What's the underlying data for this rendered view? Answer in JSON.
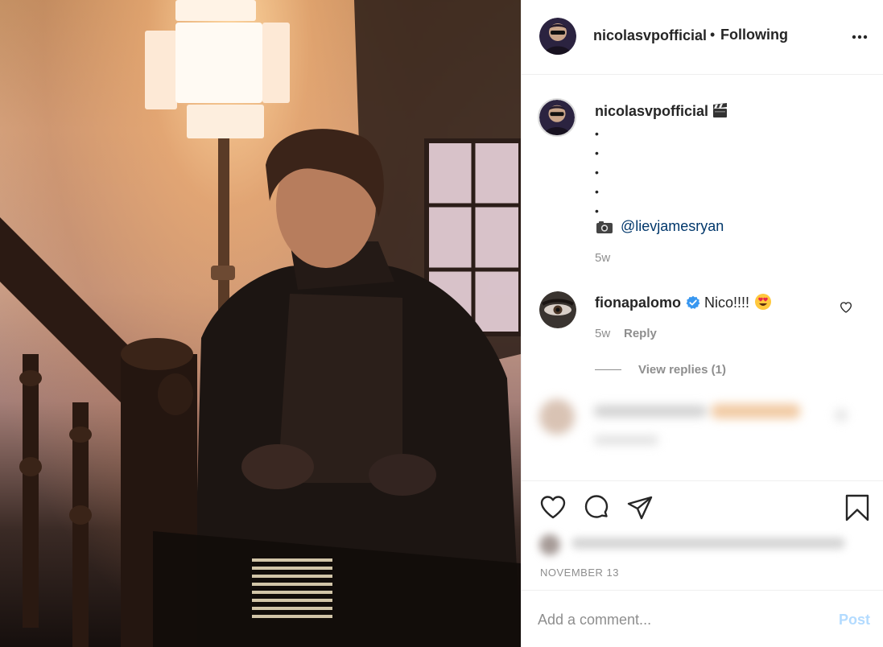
{
  "post": {
    "username": "nicolasvpofficial",
    "follow_separator": "•",
    "follow_status": "Following",
    "more_icon": "more-horizontal-icon"
  },
  "caption": {
    "username": "nicolasvpofficial",
    "emoji_icon": "clapper-board-icon",
    "bullets": [
      "•",
      "•",
      "•",
      "•",
      "•"
    ],
    "camera_icon": "camera-icon",
    "mention": "@lievjamesryan",
    "time": "5w"
  },
  "comment": {
    "username": "fionapalomo",
    "verified_icon": "verified-badge-icon",
    "text": "Nico!!!!",
    "emoji_icon": "heart-eyes-emoji-icon",
    "time": "5w",
    "reply_label": "Reply",
    "view_replies": "View replies (1)"
  },
  "actions": {
    "like_icon": "heart-icon",
    "comment_icon": "comment-icon",
    "share_icon": "paper-plane-icon",
    "save_icon": "bookmark-icon",
    "date": "NOVEMBER 13"
  },
  "composer": {
    "placeholder": "Add a comment...",
    "post_label": "Post"
  },
  "colors": {
    "accent": "#0095f6",
    "post_disabled": "#b3dbff",
    "link": "#00376b",
    "secondary_text": "#8e8e8e"
  }
}
